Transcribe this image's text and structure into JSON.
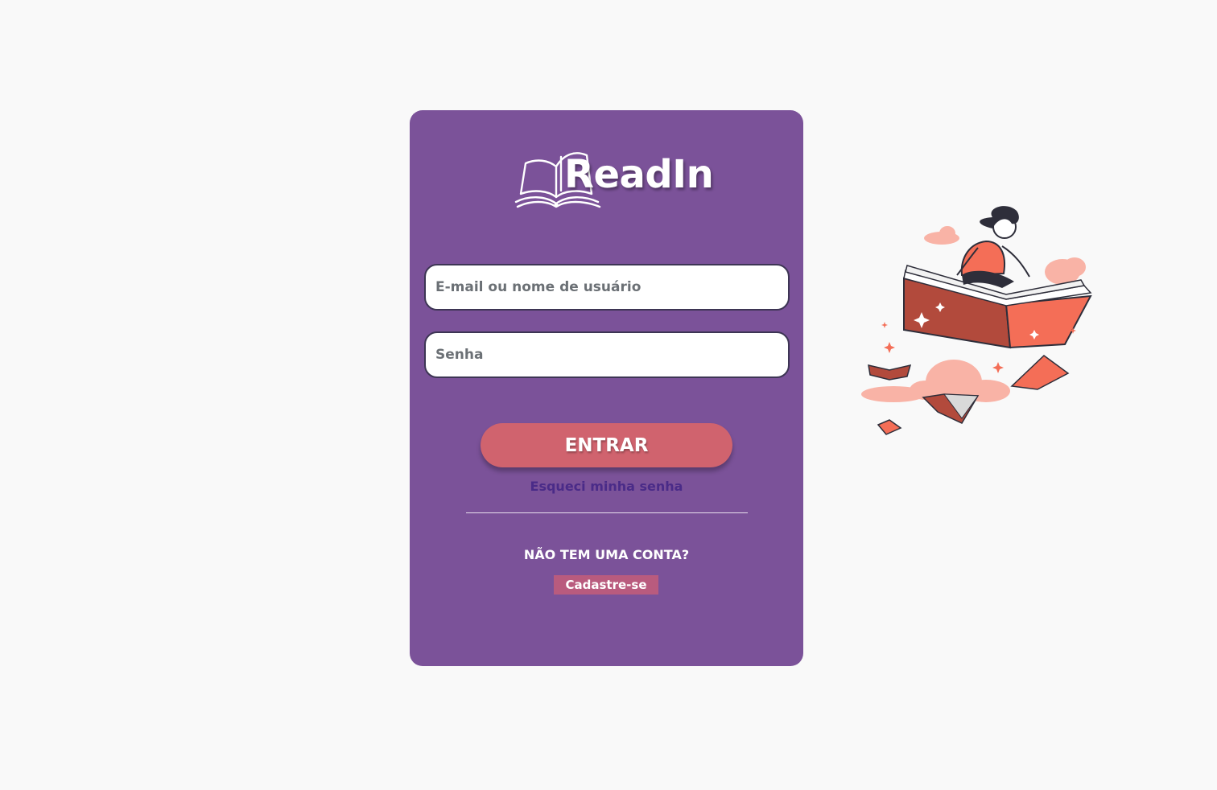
{
  "app": {
    "name": "ReadIn"
  },
  "login": {
    "email_placeholder": "E-mail ou nome de usuário",
    "password_placeholder": "Senha",
    "submit_label": "ENTRAR",
    "forgot_password": "Esqueci minha senha",
    "no_account": "NÃO TEM UMA CONTA?",
    "signup_label": "Cadastre-se"
  },
  "colors": {
    "background": "#f9f9f9",
    "card": "#7b5299",
    "button": "#d0636e",
    "link": "#4a2b88",
    "signup_bg": "#b95b7e",
    "illustration_accent": "#f46e57"
  },
  "icons": [
    "open-book-logo-icon",
    "girl-reading-flying-book-illustration"
  ]
}
